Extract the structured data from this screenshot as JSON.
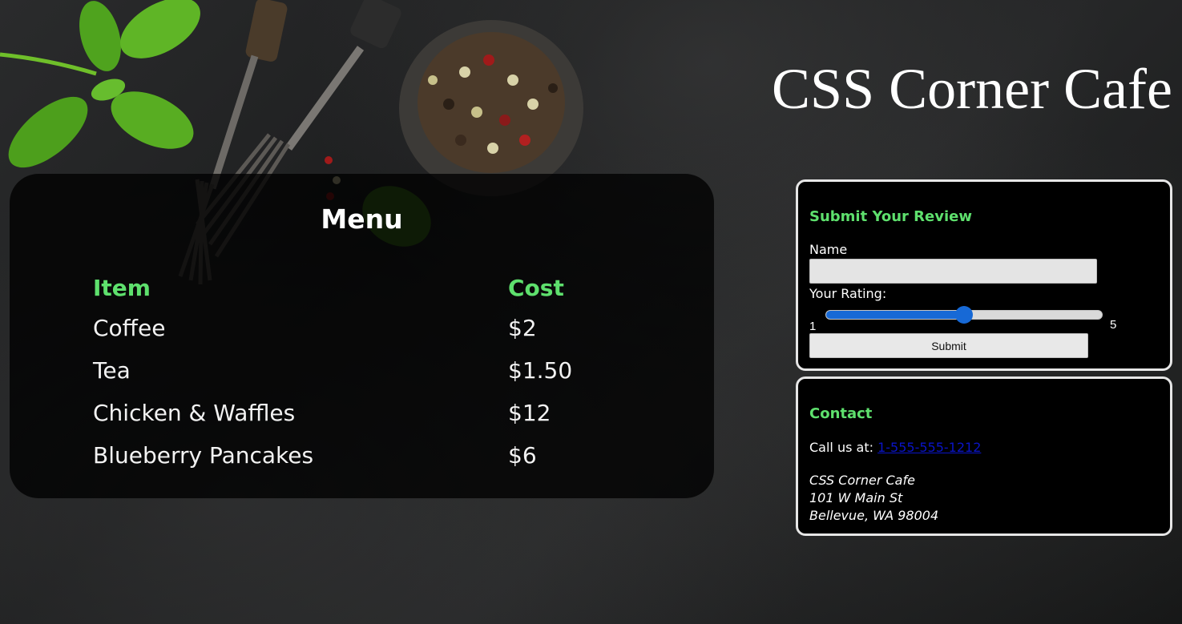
{
  "site": {
    "title": "CSS Corner Cafe"
  },
  "menu": {
    "heading": "Menu",
    "columns": [
      "Item",
      "Cost"
    ],
    "items": [
      {
        "name": "Coffee",
        "cost": "$2"
      },
      {
        "name": "Tea",
        "cost": "$1.50"
      },
      {
        "name": "Chicken & Waffles",
        "cost": "$12"
      },
      {
        "name": "Blueberry Pancakes",
        "cost": "$6"
      }
    ]
  },
  "review": {
    "heading": "Submit Your Review",
    "name_label": "Name",
    "name_value": "",
    "rating_label": "Your Rating:",
    "rating_min": "1",
    "rating_max": "5",
    "rating_fraction": 0.5,
    "submit_label": "Submit"
  },
  "contact": {
    "heading": "Contact",
    "call_label": "Call us at:",
    "phone": "1-555-555-1212",
    "address": [
      "CSS Corner Cafe",
      "101 W Main St",
      "Bellevue, WA 98004"
    ]
  },
  "colors": {
    "accent_green": "#5ee06d",
    "slider_blue": "#1769d6",
    "link_blue": "#0a14c8"
  },
  "icons": {
    "background": "food-table-photo"
  }
}
